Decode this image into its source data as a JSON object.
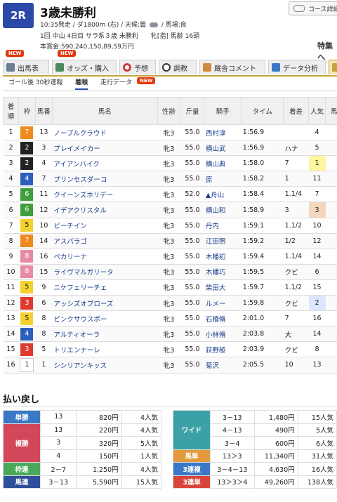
{
  "race": {
    "number": "2R",
    "name": "3歳未勝利",
    "line1": "10:35発走 / ダ1800m (右) / 天候:曇",
    "weather_icon": "cloud-icon",
    "track": "/ 馬場:良",
    "line2": "1回 中山 4日目 サラ系３歳 未勝利　　牝[指] 馬齢 16頭",
    "line3": "本賞金:590,240,150,89,59万円"
  },
  "course_button": "コース詳細",
  "tokusyu": "特集へ",
  "new_label": "NEW",
  "tabs": [
    {
      "label": "出馬表",
      "icon": "list-icon"
    },
    {
      "label": "オッズ・購入",
      "icon": "odds-icon"
    },
    {
      "label": "予想",
      "icon": "target-icon"
    },
    {
      "label": "調教",
      "icon": "stopwatch-icon"
    },
    {
      "label": "厩舎コメント",
      "icon": "stable-icon"
    },
    {
      "label": "データ分析",
      "icon": "chart-icon"
    }
  ],
  "subtabs": [
    "ゴール後 30秒速報",
    "着順",
    "走行データ"
  ],
  "table": {
    "headers": [
      "着順",
      "枠",
      "馬番",
      "馬名",
      "性齢",
      "斤量",
      "騎手",
      "タイム",
      "着差",
      "人気",
      "馬体"
    ],
    "rows": [
      {
        "pos": "1",
        "waku": "7",
        "num": "13",
        "name": "ノーブルクラウド",
        "sex": "牝3",
        "kin": "55.0",
        "jockey": "西村淳",
        "time": "1:56.9",
        "margin": "",
        "pop": "4"
      },
      {
        "pos": "2",
        "waku": "2",
        "num": "3",
        "name": "プレイメイカー",
        "sex": "牝3",
        "kin": "55.0",
        "jockey": "横山武",
        "time": "1:56.9",
        "margin": "ハナ",
        "pop": "5"
      },
      {
        "pos": "3",
        "waku": "2",
        "num": "4",
        "name": "アイアンバイク",
        "sex": "牝3",
        "kin": "55.0",
        "jockey": "横山典",
        "time": "1:58.0",
        "margin": "7",
        "pop": "1"
      },
      {
        "pos": "4",
        "waku": "4",
        "num": "7",
        "name": "プリンセスダーコ",
        "sex": "牝3",
        "kin": "55.0",
        "jockey": "原",
        "time": "1:58.2",
        "margin": "1",
        "pop": "11"
      },
      {
        "pos": "5",
        "waku": "6",
        "num": "11",
        "name": "クイーンズホリデー",
        "sex": "牝3",
        "kin": "52.0",
        "jockey": "▲舟山",
        "time": "1:58.4",
        "margin": "1.1/4",
        "pop": "7"
      },
      {
        "pos": "6",
        "waku": "6",
        "num": "12",
        "name": "イデアクリスタル",
        "sex": "牝3",
        "kin": "55.0",
        "jockey": "横山和",
        "time": "1:58.9",
        "margin": "3",
        "pop": "3"
      },
      {
        "pos": "7",
        "waku": "5",
        "num": "10",
        "name": "ビーチイン",
        "sex": "牝3",
        "kin": "55.0",
        "jockey": "丹内",
        "time": "1:59.1",
        "margin": "1.1/2",
        "pop": "10"
      },
      {
        "pos": "8",
        "waku": "7",
        "num": "14",
        "name": "アスパラゴ",
        "sex": "牝3",
        "kin": "55.0",
        "jockey": "江田照",
        "time": "1:59.2",
        "margin": "1/2",
        "pop": "12"
      },
      {
        "pos": "9",
        "waku": "8",
        "num": "16",
        "name": "ペカリーナ",
        "sex": "牝3",
        "kin": "55.0",
        "jockey": "木幡初",
        "time": "1:59.4",
        "margin": "1.1/4",
        "pop": "14"
      },
      {
        "pos": "10",
        "waku": "8",
        "num": "15",
        "name": "ライヴマルガリータ",
        "sex": "牝3",
        "kin": "55.0",
        "jockey": "木幡巧",
        "time": "1:59.5",
        "margin": "クビ",
        "pop": "6"
      },
      {
        "pos": "11",
        "waku": "5",
        "num": "9",
        "name": "ニケフェリーチェ",
        "sex": "牝3",
        "kin": "55.0",
        "jockey": "柴田大",
        "time": "1:59.7",
        "margin": "1.1/2",
        "pop": "15"
      },
      {
        "pos": "12",
        "waku": "3",
        "num": "6",
        "name": "アッシズオブローズ",
        "sex": "牝3",
        "kin": "55.0",
        "jockey": "ルメー",
        "time": "1:59.8",
        "margin": "クビ",
        "pop": "2"
      },
      {
        "pos": "13",
        "waku": "5",
        "num": "8",
        "name": "ピンクサウスポー",
        "sex": "牝3",
        "kin": "55.0",
        "jockey": "石橋脩",
        "time": "2:01.0",
        "margin": "7",
        "pop": "16"
      },
      {
        "pos": "14",
        "waku": "4",
        "num": "8",
        "name": "アルティオーラ",
        "sex": "牝3",
        "kin": "55.0",
        "jockey": "小林脩",
        "time": "2:03.8",
        "margin": "大",
        "pop": "14"
      },
      {
        "pos": "15",
        "waku": "3",
        "num": "5",
        "name": "トリエンナーレ",
        "sex": "牝3",
        "kin": "55.0",
        "jockey": "荻野極",
        "time": "2:03.9",
        "margin": "クビ",
        "pop": "8"
      },
      {
        "pos": "16",
        "waku": "1",
        "num": "1",
        "name": "シシリアンキッス",
        "sex": "牝3",
        "kin": "55.0",
        "jockey": "菊沢",
        "time": "2:05.5",
        "margin": "10",
        "pop": "13"
      }
    ]
  },
  "waku_colors": {
    "1": {
      "bg": "#ffffff",
      "fg": "#222222"
    },
    "2": {
      "bg": "#222222",
      "fg": "#ffffff"
    },
    "3": {
      "bg": "#e03a2f",
      "fg": "#ffffff"
    },
    "4": {
      "bg": "#2b5fbd",
      "fg": "#ffffff"
    },
    "5": {
      "bg": "#f3d12f",
      "fg": "#222222"
    },
    "6": {
      "bg": "#3f9e3d",
      "fg": "#ffffff"
    },
    "7": {
      "bg": "#f08a1c",
      "fg": "#ffffff"
    },
    "8": {
      "bg": "#e98aa3",
      "fg": "#ffffff"
    }
  },
  "payout_title": "払い戻し",
  "payout_left": [
    {
      "type": "単勝",
      "color": "#3a78c7",
      "rows": [
        {
          "combo": "13",
          "amount": "820円",
          "pop": "4人気"
        }
      ]
    },
    {
      "type": "複勝",
      "color": "#d2475a",
      "rows": [
        {
          "combo": "13",
          "amount": "220円",
          "pop": "4人気"
        },
        {
          "combo": "3",
          "amount": "320円",
          "pop": "5人気"
        },
        {
          "combo": "4",
          "amount": "150円",
          "pop": "1人気"
        }
      ]
    },
    {
      "type": "枠連",
      "color": "#4aa85a",
      "rows": [
        {
          "combo": "2－7",
          "amount": "1,250円",
          "pop": "4人気"
        }
      ]
    },
    {
      "type": "馬連",
      "color": "#2f4e9b",
      "rows": [
        {
          "combo": "3－13",
          "amount": "5,590円",
          "pop": "15人気"
        }
      ]
    }
  ],
  "payout_right": [
    {
      "type": "ワイド",
      "color": "#3ca0a8",
      "rows": [
        {
          "combo": "3－13",
          "amount": "1,480円",
          "pop": "15人気"
        },
        {
          "combo": "4－13",
          "amount": "490円",
          "pop": "5人気"
        },
        {
          "combo": "3－4",
          "amount": "600円",
          "pop": "6人気"
        }
      ]
    },
    {
      "type": "馬単",
      "color": "#e49a3c",
      "rows": [
        {
          "combo": "13＞3",
          "amount": "11,340円",
          "pop": "31人気"
        }
      ]
    },
    {
      "type": "3連複",
      "color": "#3a78c7",
      "rows": [
        {
          "combo": "3－4－13",
          "amount": "4,630円",
          "pop": "16人気"
        }
      ]
    },
    {
      "type": "3連単",
      "color": "#d8463b",
      "rows": [
        {
          "combo": "13＞3＞4",
          "amount": "49,260円",
          "pop": "138人気"
        }
      ]
    }
  ]
}
